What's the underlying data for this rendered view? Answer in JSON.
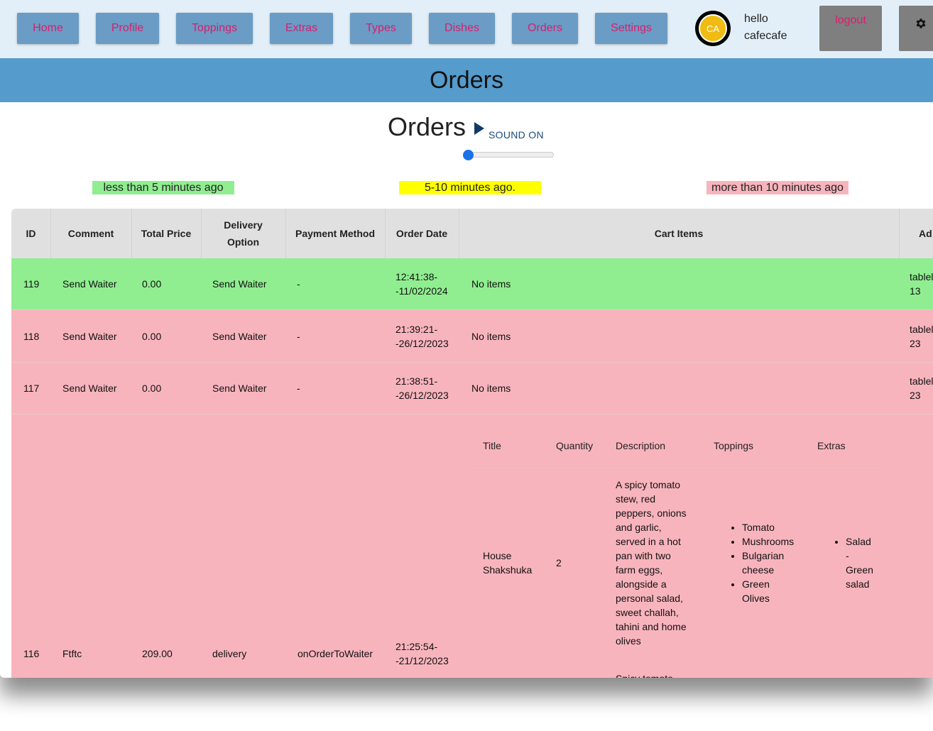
{
  "nav": {
    "items": [
      "Home",
      "Profile",
      "Toppings",
      "Extras",
      "Types",
      "Dishes",
      "Orders",
      "Settings"
    ],
    "avatar_initials": "CA",
    "greeting_line1": "hello",
    "greeting_line2": "cafecafe",
    "logout_label": "logout",
    "settings_icon": "gear-icon"
  },
  "banner": {
    "title": "Orders"
  },
  "orders_header": {
    "title": "Orders",
    "sound_label": "SOUND ON",
    "volume": 0
  },
  "legend": [
    {
      "label": "less than 5 minutes ago",
      "color": "#90ee90"
    },
    {
      "label": "5-10 minutes ago.",
      "color": "#ffff00"
    },
    {
      "label": "more than 10 minutes ago",
      "color": "#f8b4bd"
    }
  ],
  "table": {
    "columns": [
      "ID",
      "Comment",
      "Total Price",
      "Delivery Option",
      "Payment Method",
      "Order Date",
      "Cart Items",
      "Ad"
    ],
    "delivery_option_lines": [
      "Delivery",
      "Option"
    ],
    "rows": [
      {
        "id": "119",
        "comment": "Send Waiter",
        "total": "0.00",
        "delivery": "Send Waiter",
        "payment": "-",
        "date_line1": "12:41:38-",
        "date_line2": "-11/02/2024",
        "cart": "No items",
        "addr_line1": "tablel",
        "addr_line2": "13",
        "status_color": "#90ee90"
      },
      {
        "id": "118",
        "comment": "Send Waiter",
        "total": "0.00",
        "delivery": "Send Waiter",
        "payment": "-",
        "date_line1": "21:39:21-",
        "date_line2": "-26/12/2023",
        "cart": "No items",
        "addr_line1": "tablel",
        "addr_line2": "23",
        "status_color": "#f8b4bd"
      },
      {
        "id": "117",
        "comment": "Send Waiter",
        "total": "0.00",
        "delivery": "Send Waiter",
        "payment": "-",
        "date_line1": "21:38:51-",
        "date_line2": "-26/12/2023",
        "cart": "No items",
        "addr_line1": "tablel",
        "addr_line2": "23",
        "status_color": "#f8b4bd"
      },
      {
        "id": "116",
        "comment": "Ftftc",
        "total": "209.00",
        "delivery": "delivery",
        "payment": "onOrderToWaiter",
        "date_line1": "21:25:54-",
        "date_line2": "-21/12/2023",
        "status_color": "#f8b4bd"
      }
    ]
  },
  "cart_table": {
    "columns": [
      "Title",
      "Quantity",
      "Description",
      "Toppings",
      "Extras"
    ],
    "item": {
      "title_line1": "House",
      "title_line2": "Shakshuka",
      "quantity": "2",
      "description_lines": [
        "A spicy tomato",
        "stew, red",
        "peppers, onions",
        "and garlic,",
        "served in a hot",
        "pan with two",
        "farm eggs,",
        "alongside a",
        "personal salad,",
        "sweet challah,",
        "tahini and home",
        "olives"
      ],
      "toppings": [
        [
          "Tomato"
        ],
        [
          "Mushrooms"
        ],
        [
          "Bulgarian",
          "cheese"
        ],
        [
          "Green",
          "Olives"
        ]
      ],
      "extras_lines": [
        "Salad",
        "-",
        "Green",
        "salad"
      ]
    },
    "next_description_partial": "Spicy tomato"
  }
}
